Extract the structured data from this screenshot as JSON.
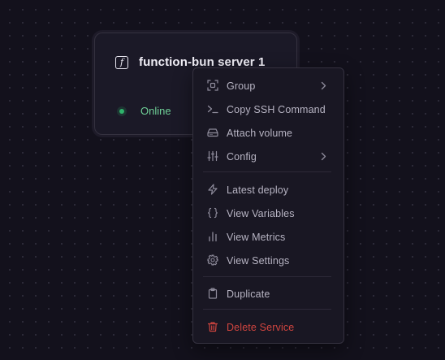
{
  "service_card": {
    "icon": "function-icon",
    "icon_glyph": "f",
    "title": "function-bun server 1",
    "status": "Online",
    "status_color": "#2fb36b"
  },
  "context_menu": {
    "items": [
      {
        "label": "Group",
        "icon": "group-icon",
        "submenu": true
      },
      {
        "label": "Copy SSH Command",
        "icon": "terminal-icon",
        "submenu": false
      },
      {
        "label": "Attach volume",
        "icon": "hard-drive-icon",
        "submenu": false
      },
      {
        "label": "Config",
        "icon": "sliders-icon",
        "submenu": true
      },
      {
        "label": "Latest deploy",
        "icon": "lightning-icon",
        "submenu": false
      },
      {
        "label": "View Variables",
        "icon": "braces-icon",
        "submenu": false
      },
      {
        "label": "View Metrics",
        "icon": "bar-chart-icon",
        "submenu": false
      },
      {
        "label": "View Settings",
        "icon": "gear-icon",
        "submenu": false
      },
      {
        "label": "Duplicate",
        "icon": "clipboard-icon",
        "submenu": false
      },
      {
        "label": "Delete Service",
        "icon": "trash-icon",
        "submenu": false
      }
    ],
    "danger_color": "#d0453f"
  }
}
